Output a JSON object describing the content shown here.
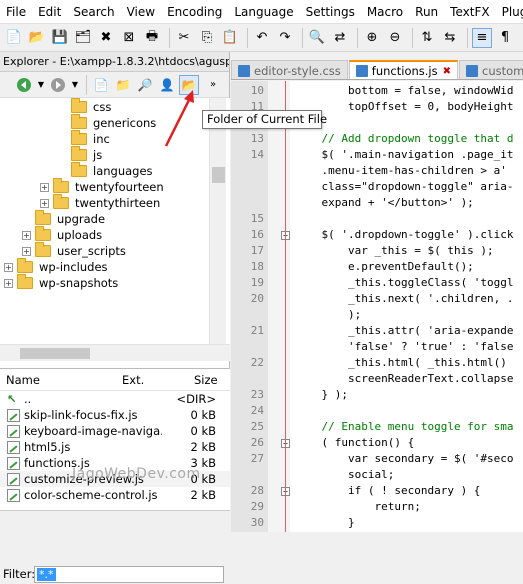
{
  "menu": [
    "File",
    "Edit",
    "Search",
    "View",
    "Encoding",
    "Language",
    "Settings",
    "Macro",
    "Run",
    "TextFX",
    "Plugins"
  ],
  "explorer": {
    "title": "Explorer - E:\\xampp-1.8.3.2\\htdocs\\agusp...",
    "close": "×",
    "tooltip": "Folder of Current File",
    "tree": [
      {
        "label": "css",
        "depth": 4,
        "expander": ""
      },
      {
        "label": "genericons",
        "depth": 4,
        "expander": ""
      },
      {
        "label": "inc",
        "depth": 4,
        "expander": ""
      },
      {
        "label": "js",
        "depth": 4,
        "expander": ""
      },
      {
        "label": "languages",
        "depth": 4,
        "expander": ""
      },
      {
        "label": "twentyfourteen",
        "depth": 3,
        "expander": "+"
      },
      {
        "label": "twentythirteen",
        "depth": 3,
        "expander": "+"
      },
      {
        "label": "upgrade",
        "depth": 2,
        "expander": ""
      },
      {
        "label": "uploads",
        "depth": 2,
        "expander": "+"
      },
      {
        "label": "user_scripts",
        "depth": 2,
        "expander": "+"
      },
      {
        "label": "wp-includes",
        "depth": 1,
        "expander": "+"
      },
      {
        "label": "wp-snapshots",
        "depth": 1,
        "expander": "+"
      }
    ],
    "columns": {
      "name": "Name",
      "ext": "Ext.",
      "size": "Size"
    },
    "files": [
      {
        "name": "..",
        "size": "<DIR>"
      },
      {
        "name": "skip-link-focus-fix.js",
        "size": "0 kB"
      },
      {
        "name": "keyboard-image-naviga...",
        "size": "0 kB"
      },
      {
        "name": "html5.js",
        "size": "2 kB"
      },
      {
        "name": "functions.js",
        "size": "3 kB"
      },
      {
        "name": "customize-preview.js",
        "size": "0 kB"
      },
      {
        "name": "color-scheme-control.js",
        "size": "2 kB"
      }
    ],
    "filter_label": "Filter:",
    "filter_value": "*.*"
  },
  "tabs": [
    {
      "label": "editor-style.css",
      "active": false
    },
    {
      "label": "functions.js",
      "active": true
    },
    {
      "label": "customize-previ",
      "active": false
    }
  ],
  "editor": {
    "lines": [
      {
        "n": "10",
        "text": "        bottom = false, windowWid"
      },
      {
        "n": "11",
        "text": "        topOffset = 0, bodyHeight"
      },
      {
        "n": "12",
        "text": ""
      },
      {
        "n": "13",
        "text": "    // Add dropdown toggle that d"
      },
      {
        "n": "14",
        "text": "    $( '.main-navigation .page_it"
      },
      {
        "n": "",
        "text": "    .menu-item-has-children > a'"
      },
      {
        "n": "",
        "text": "    class=\"dropdown-toggle\" aria-"
      },
      {
        "n": "",
        "text": "    expand + '</button>' );"
      },
      {
        "n": "15",
        "text": ""
      },
      {
        "n": "16",
        "text": "    $( '.dropdown-toggle' ).click"
      },
      {
        "n": "17",
        "text": "        var _this = $( this );"
      },
      {
        "n": "18",
        "text": "        e.preventDefault();"
      },
      {
        "n": "19",
        "text": "        _this.toggleClass( 'toggl"
      },
      {
        "n": "20",
        "text": "        _this.next( '.children, ."
      },
      {
        "n": "",
        "text": "        );"
      },
      {
        "n": "21",
        "text": "        _this.attr( 'aria-expande"
      },
      {
        "n": "",
        "text": "        'false' ? 'true' : 'false"
      },
      {
        "n": "22",
        "text": "        _this.html( _this.html()"
      },
      {
        "n": "",
        "text": "        screenReaderText.collapse"
      },
      {
        "n": "23",
        "text": "    } );"
      },
      {
        "n": "24",
        "text": ""
      },
      {
        "n": "25",
        "text": "    // Enable menu toggle for sma"
      },
      {
        "n": "26",
        "text": "    ( function() {"
      },
      {
        "n": "27",
        "text": "        var secondary = $( '#seco"
      },
      {
        "n": "",
        "text": "        social;"
      },
      {
        "n": "28",
        "text": "        if ( ! secondary ) {"
      },
      {
        "n": "29",
        "text": "            return;"
      },
      {
        "n": "30",
        "text": "        }"
      }
    ]
  },
  "watermark": "JagoWebDev.com"
}
